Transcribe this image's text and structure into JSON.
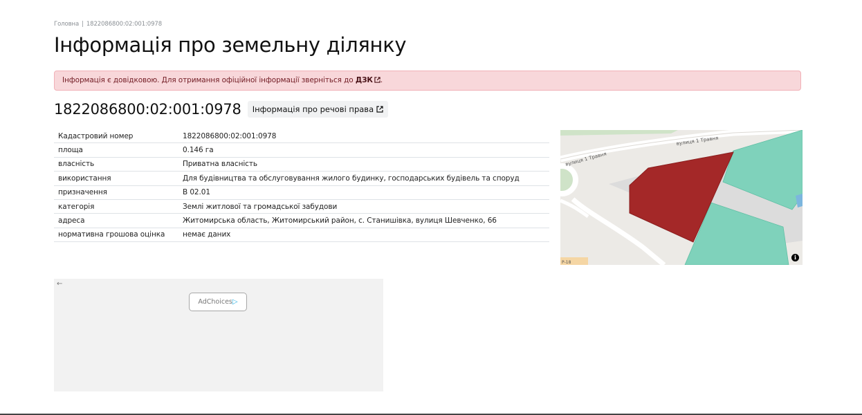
{
  "breadcrumb": {
    "home": "Головна",
    "separator": "|",
    "current": "1822086800:02:001:0978"
  },
  "page_title": "Інформація про земельну ділянку",
  "alert": {
    "text": "Інформація є довідковою. Для отримання офіційної інформації зверніться до",
    "link": "ДЗК",
    "suffix": "."
  },
  "parcel": {
    "id": "1822086800:02:001:0978",
    "rights_button": "Інформація про речові права"
  },
  "details": [
    {
      "key": "Кадастровий номер",
      "value": "1822086800:02:001:0978"
    },
    {
      "key": "площа",
      "value": "0.146 га"
    },
    {
      "key": "власність",
      "value": "Приватна власність"
    },
    {
      "key": "використання",
      "value": "Для будівництва та обслуговування жилого будинку, господарських будівель та споруд"
    },
    {
      "key": "призначення",
      "value": "В 02.01"
    },
    {
      "key": "категорія",
      "value": "Землі житлової та громадської забудови"
    },
    {
      "key": "адреса",
      "value": "Житомирська область, Житомирський район, с. Станишівка, вулиця Шевченко, 66"
    },
    {
      "key": "нормативна грошова оцінка",
      "value": "немає даних"
    }
  ],
  "map": {
    "street_label_1": "вулиця 1 Травня",
    "street_label_2": "вулиця 1 Травня",
    "road_label": "Р-18",
    "info_icon": "info-icon",
    "colors": {
      "parcel": "#a42828",
      "neighbor": "#7fd2bb",
      "ground": "#eceae6",
      "road": "#ffffff",
      "green": "#cfe3c8"
    }
  },
  "ad": {
    "back_icon": "arrow-left-icon",
    "adchoices_label": "AdChoices",
    "adchoices_icon": "▷"
  }
}
